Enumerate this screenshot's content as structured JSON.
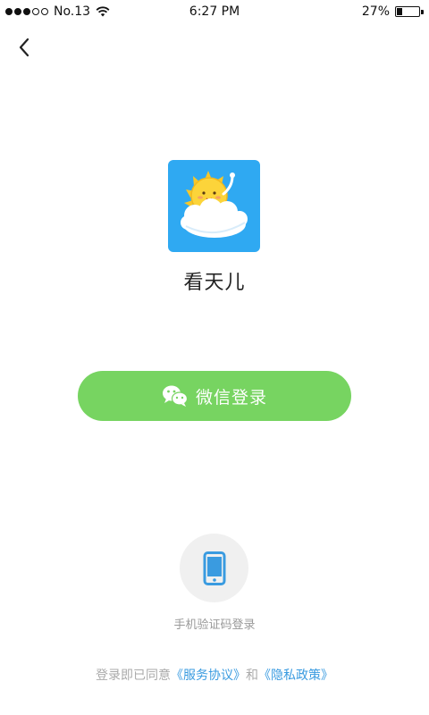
{
  "status_bar": {
    "carrier": "No.13",
    "time": "6:27 PM",
    "battery": "27%",
    "battery_level": 0.27
  },
  "app": {
    "name": "看天儿"
  },
  "wechat_login": {
    "label": "微信登录",
    "color": "#77d461"
  },
  "phone_login": {
    "label": "手机验证码登录"
  },
  "agreement": {
    "prefix": "登录即已同意",
    "terms": "《服务协议》",
    "and": "和",
    "privacy": "《隐私政策》",
    "link_color": "#3a9be0"
  },
  "icons": {
    "back": "chevron-left-icon",
    "wechat": "wechat-icon",
    "phone": "phone-icon",
    "wifi": "wifi-icon",
    "battery": "battery-icon"
  }
}
